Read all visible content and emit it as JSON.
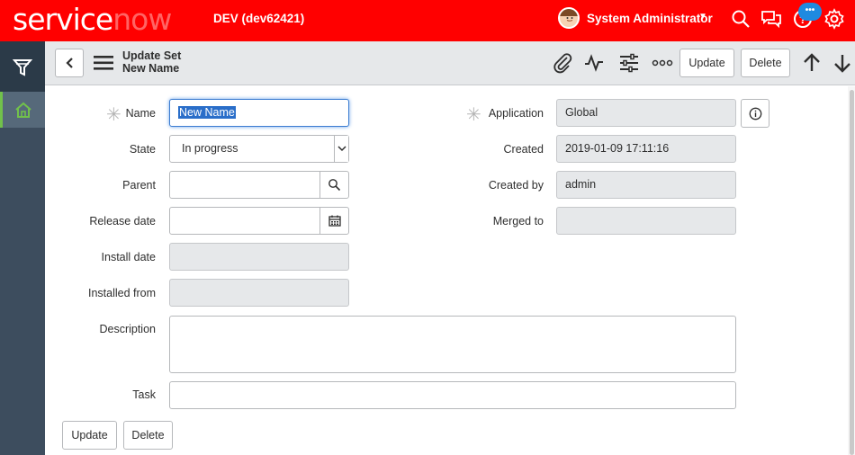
{
  "banner": {
    "logo_part1": "service",
    "logo_part2": "now",
    "instance": "DEV (dev62421)",
    "user_name": "System Administrator",
    "user_caret": "▼",
    "chat_badge": "•••"
  },
  "form_header": {
    "title": "Update Set",
    "subtitle": "New Name",
    "update_label": "Update",
    "delete_label": "Delete"
  },
  "fields": {
    "name": {
      "label": "Name",
      "value": "New Name",
      "required_mark": "✳"
    },
    "state": {
      "label": "State",
      "value": "In progress"
    },
    "parent": {
      "label": "Parent",
      "value": ""
    },
    "release_date": {
      "label": "Release date",
      "value": ""
    },
    "install_date": {
      "label": "Install date",
      "value": ""
    },
    "installed_from": {
      "label": "Installed from",
      "value": ""
    },
    "description": {
      "label": "Description",
      "value": ""
    },
    "task": {
      "label": "Task",
      "value": ""
    },
    "application": {
      "label": "Application",
      "value": "Global",
      "required_mark": "✳"
    },
    "created": {
      "label": "Created",
      "value": "2019-01-09 17:11:16"
    },
    "created_by": {
      "label": "Created by",
      "value": "admin"
    },
    "merged_to": {
      "label": "Merged to",
      "value": ""
    }
  },
  "footer": {
    "update_label": "Update",
    "delete_label": "Delete"
  },
  "colors": {
    "banner": "#ff0000",
    "rail": "#3d4d5e",
    "accent": "#71c14b",
    "focus": "#3c7dd1"
  }
}
